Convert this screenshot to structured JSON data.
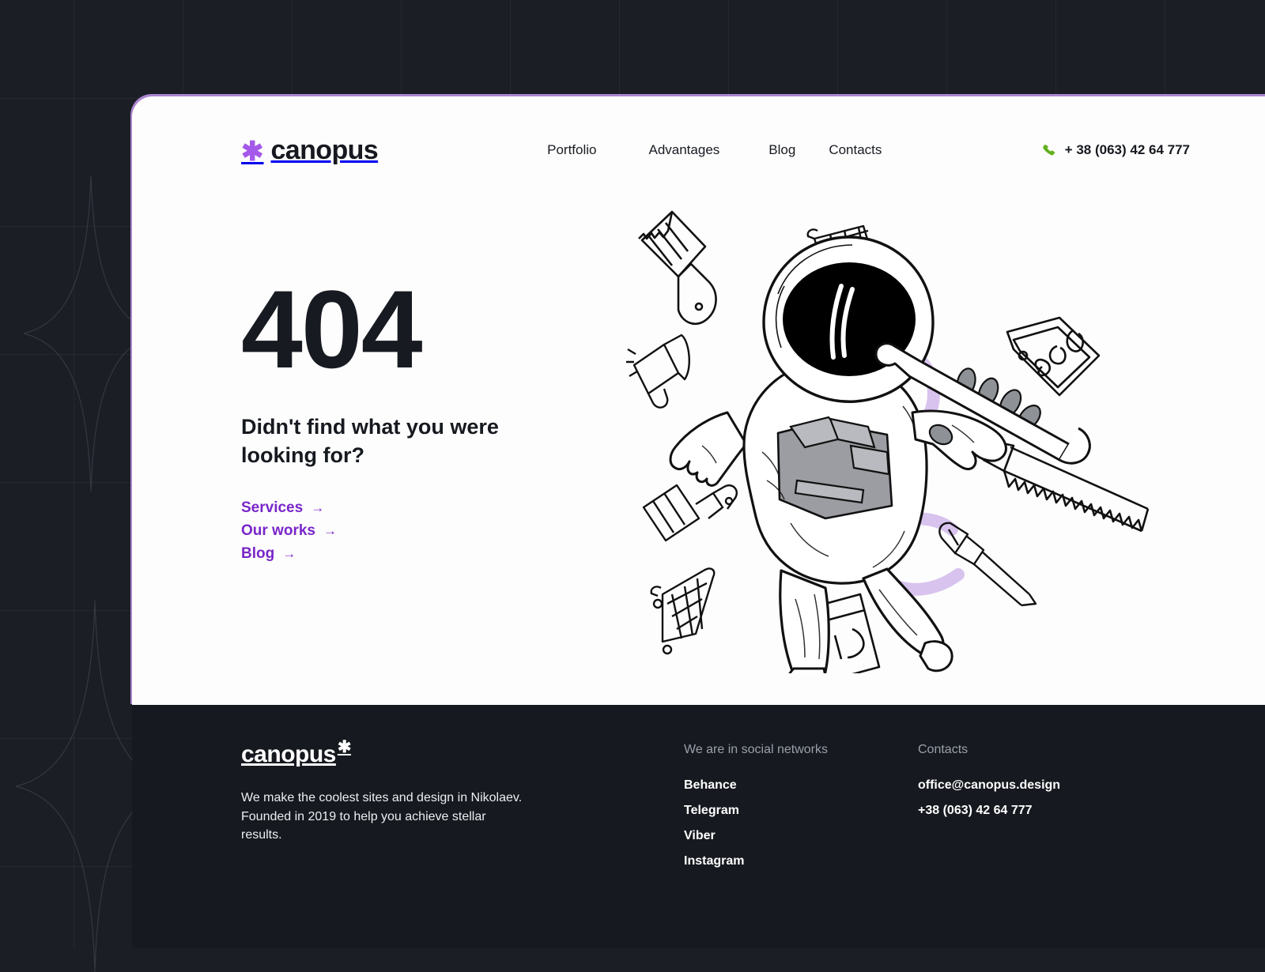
{
  "theme": {
    "accent_purple": "#7926c9",
    "logo_purple": "#a459ea",
    "phone_green": "#63b01f",
    "dark_bg": "#1b1e25",
    "footer_bg": "#16191f",
    "card_bg": "#fdfdfd"
  },
  "header": {
    "logo": {
      "mark": "asterisk-icon",
      "text": "canopus"
    },
    "nav": [
      {
        "label": "Portfolio"
      },
      {
        "label": "Advantages"
      },
      {
        "label": "Blog"
      },
      {
        "label": "Contacts"
      }
    ],
    "phone": {
      "icon": "phone-icon",
      "number": "+ 38 (063) 42 64 777"
    }
  },
  "hero": {
    "error_code": "404",
    "subtitle": "Didn't find what you were looking for?",
    "links": [
      {
        "label": "Services",
        "arrow": "→"
      },
      {
        "label": "Our works",
        "arrow": "→"
      },
      {
        "label": "Blog",
        "arrow": "→"
      }
    ],
    "illustration": {
      "name": "astronaut-with-wrench-illustration",
      "doodles": [
        "paint-brush-icon",
        "shopping-cart-icon",
        "megaphone-icon",
        "seo-price-tag-icon",
        "hand-saw-icon",
        "paint-roller-icon",
        "screwdriver-icon",
        "shopping-basket-icon",
        "code-window-icon"
      ]
    }
  },
  "footer": {
    "logo": {
      "text": "canopus",
      "mark": "asterisk-icon"
    },
    "description": "We make the coolest sites and design in Nikolaev. Founded in 2019 to help you achieve stellar results.",
    "social": {
      "title": "We are in social networks",
      "items": [
        {
          "label": "Behance"
        },
        {
          "label": "Telegram"
        },
        {
          "label": "Viber"
        },
        {
          "label": "Instagram"
        }
      ]
    },
    "contacts": {
      "title": "Contacts",
      "items": [
        {
          "label": "office@canopus.design"
        },
        {
          "label": "+38 (063) 42 64 777"
        }
      ]
    }
  }
}
